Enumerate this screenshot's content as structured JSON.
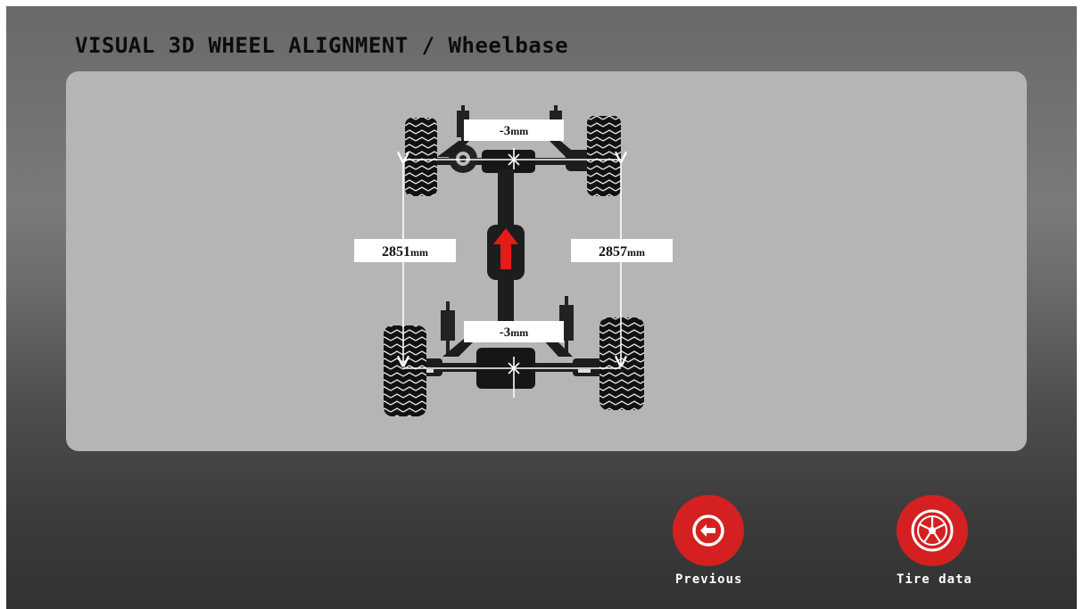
{
  "header": {
    "title": "VISUAL 3D WHEEL ALIGNMENT / Wheelbase"
  },
  "measurements": {
    "front_offset": "-3",
    "rear_offset": "-3",
    "left_wheelbase": "2851",
    "right_wheelbase": "2857",
    "unit": "mm"
  },
  "buttons": {
    "previous": {
      "label": "Previous",
      "icon": "arrow-left-circle-icon"
    },
    "tire_data": {
      "label": "Tire data",
      "icon": "wheel-rim-icon"
    }
  },
  "colors": {
    "accent": "#d42020",
    "panel": "#b5b5b5",
    "direction_arrow": "#e41b17"
  }
}
